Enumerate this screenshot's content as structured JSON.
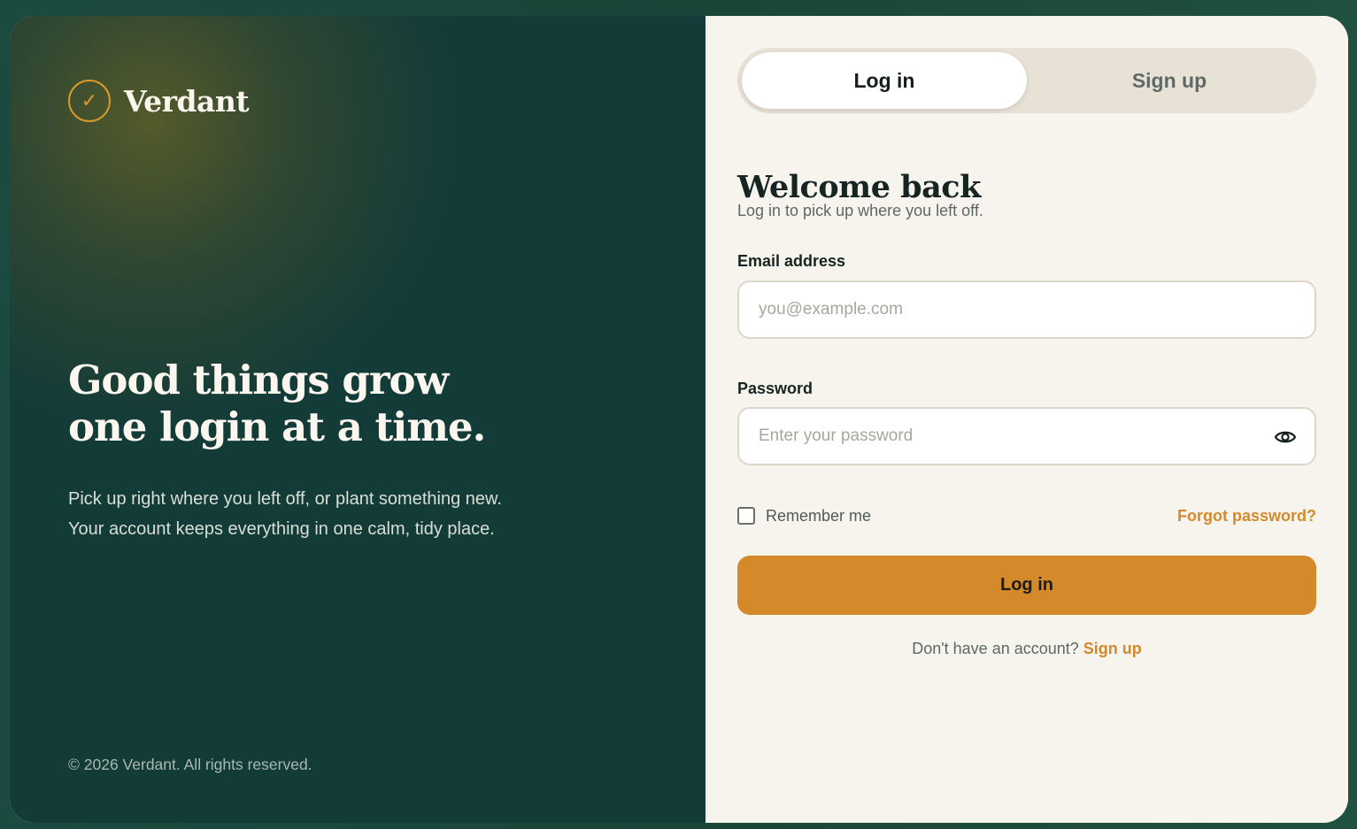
{
  "brand": {
    "name": "Verdant",
    "mark": "✓"
  },
  "hero": {
    "headline_line1": "Good things grow",
    "headline_line2": "one login at a time.",
    "sub_line1": "Pick up right where you left off, or plant something new.",
    "sub_line2": "Your account keeps everything in one calm, tidy place."
  },
  "copyright": "© 2026 Verdant. All rights reserved.",
  "tabs": {
    "login": "Log in",
    "signup": "Sign up",
    "active": "login"
  },
  "form": {
    "title": "Welcome back",
    "subtitle": "Log in to pick up where you left off.",
    "email_label": "Email address",
    "email_placeholder": "you@example.com",
    "email_value": "",
    "password_label": "Password",
    "password_placeholder": "Enter your password",
    "password_value": "",
    "remember_label": "Remember me",
    "remember_checked": false,
    "forgot_label": "Forgot password?",
    "submit_label": "Log in",
    "footer_text": "Don't have an account?",
    "footer_link": "Sign up"
  },
  "icons": {
    "brand": "check-circle-icon",
    "password_toggle": "eye-icon"
  },
  "colors": {
    "panel_dark": "#133b38",
    "accent": "#d4892b",
    "surface": "#f7f4ee",
    "tab_track": "#e8e1d6"
  }
}
